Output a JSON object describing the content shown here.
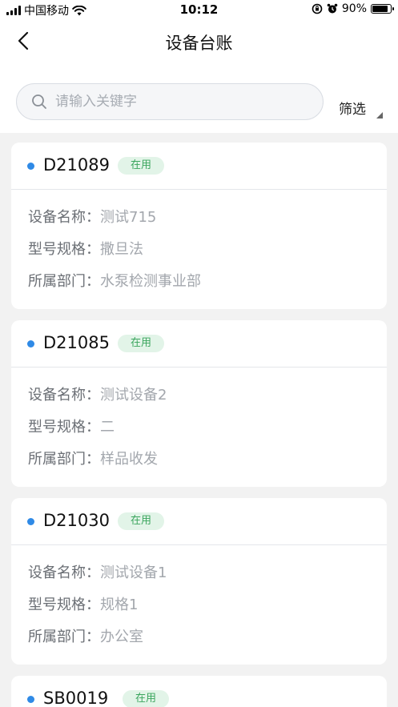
{
  "status_bar": {
    "carrier": "中国移动",
    "time": "10:12",
    "battery": "90%",
    "battery_level": 0.9
  },
  "nav": {
    "title": "设备台账"
  },
  "search": {
    "placeholder": "请输入关键字",
    "filter_label": "筛选"
  },
  "field_labels": {
    "name": "设备名称：",
    "model": "型号规格：",
    "dept": "所属部门："
  },
  "devices": [
    {
      "code": "D21089",
      "status": "在用",
      "name": "测试715",
      "model": "撒旦法",
      "dept": "水泵检测事业部"
    },
    {
      "code": "D21085",
      "status": "在用",
      "name": "测试设备2",
      "model": "二",
      "dept": "样品收发"
    },
    {
      "code": "D21030",
      "status": "在用",
      "name": "测试设备1",
      "model": "规格1",
      "dept": "办公室"
    },
    {
      "code": "SB0019",
      "status": "在用"
    }
  ],
  "colors": {
    "accent_dot": "#2f8ae6",
    "badge_bg": "#e2f4e8",
    "badge_text": "#3aa55d"
  }
}
